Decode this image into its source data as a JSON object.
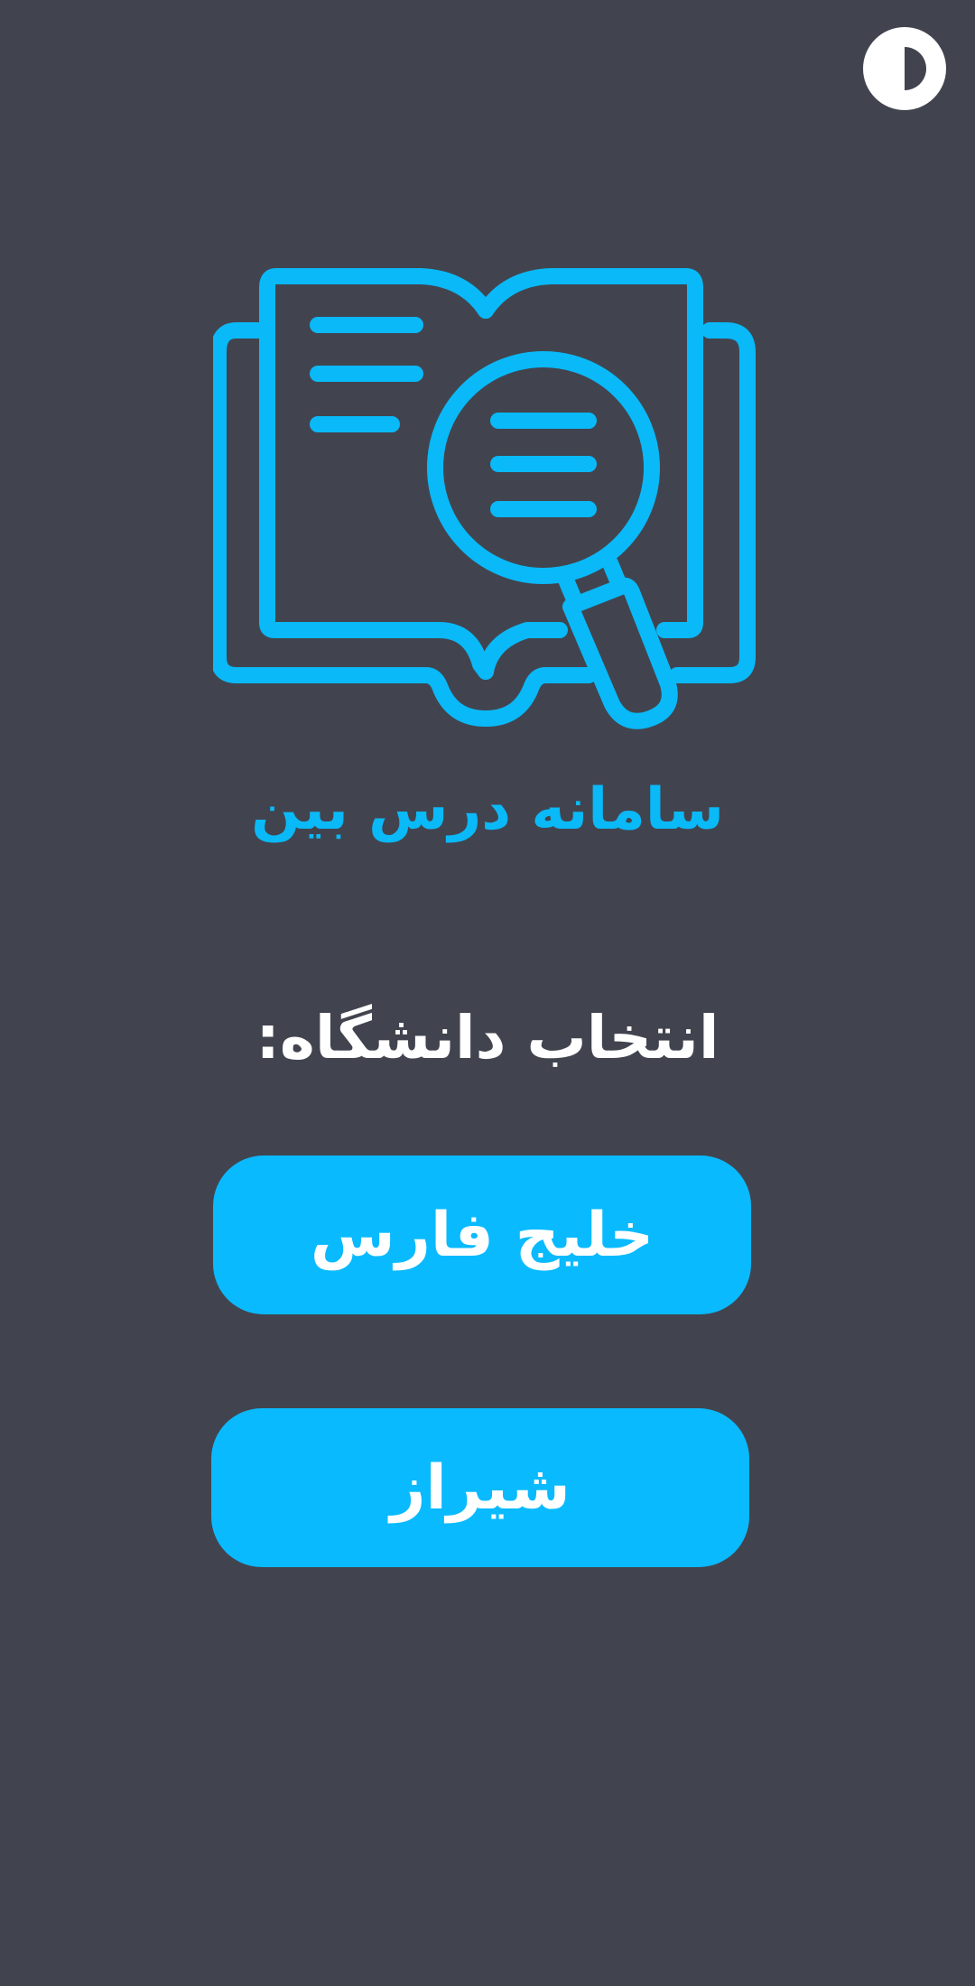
{
  "theme_toggle": {
    "icon": "contrast-icon"
  },
  "hero": {
    "icon": "book-search-icon",
    "accent_color": "#0ab9f7"
  },
  "app": {
    "title": "سامانه درس بین"
  },
  "selection": {
    "heading": "انتخاب دانشگاه:",
    "universities": [
      {
        "label": "خلیج فارس"
      },
      {
        "label": "شیراز"
      }
    ]
  },
  "colors": {
    "background": "#41444f",
    "accent": "#0ab9f7",
    "button_text": "#ffffff"
  }
}
